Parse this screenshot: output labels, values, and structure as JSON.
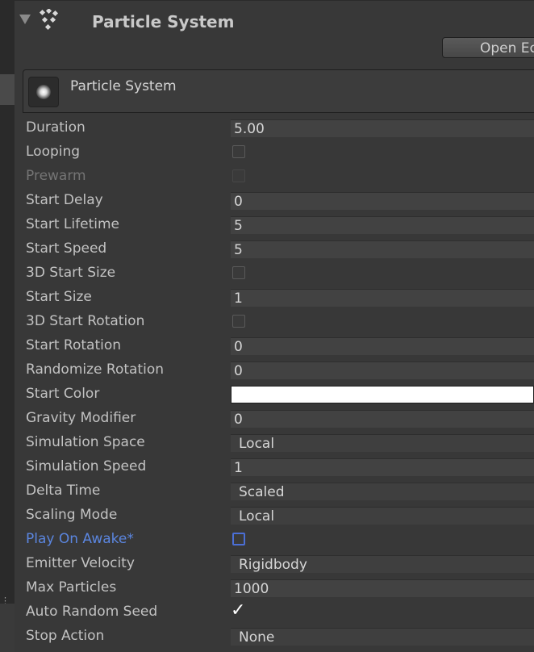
{
  "header": {
    "title": "Particle System",
    "open_editor_label": "Open Ec"
  },
  "module": {
    "title": "Particle System"
  },
  "properties": [
    {
      "label": "Duration",
      "type": "number",
      "value": "5.00"
    },
    {
      "label": "Looping",
      "type": "checkbox",
      "checked": false
    },
    {
      "label": "Prewarm",
      "type": "checkbox",
      "checked": false,
      "disabled": true
    },
    {
      "label": "Start Delay",
      "type": "number",
      "value": "0"
    },
    {
      "label": "Start Lifetime",
      "type": "number",
      "value": "5"
    },
    {
      "label": "Start Speed",
      "type": "number",
      "value": "5"
    },
    {
      "label": "3D Start Size",
      "type": "checkbox",
      "checked": false
    },
    {
      "label": "Start Size",
      "type": "number",
      "value": "1"
    },
    {
      "label": "3D Start Rotation",
      "type": "checkbox",
      "checked": false
    },
    {
      "label": "Start Rotation",
      "type": "number",
      "value": "0"
    },
    {
      "label": "Randomize Rotation",
      "type": "number",
      "value": "0"
    },
    {
      "label": "Start Color",
      "type": "color",
      "value": "#ffffff"
    },
    {
      "label": "Gravity Modifier",
      "type": "number",
      "value": "0"
    },
    {
      "label": "Simulation Space",
      "type": "dropdown",
      "value": "Local"
    },
    {
      "label": "Simulation Speed",
      "type": "number",
      "value": "1"
    },
    {
      "label": "Delta Time",
      "type": "dropdown",
      "value": "Scaled"
    },
    {
      "label": "Scaling Mode",
      "type": "dropdown",
      "value": "Local"
    },
    {
      "label": "Play On Awake*",
      "type": "checkbox",
      "checked": false,
      "modified": true
    },
    {
      "label": "Emitter Velocity",
      "type": "dropdown",
      "value": "Rigidbody"
    },
    {
      "label": "Max Particles",
      "type": "number",
      "value": "1000"
    },
    {
      "label": "Auto Random Seed",
      "type": "checkbox",
      "checked": true
    },
    {
      "label": "Stop Action",
      "type": "dropdown",
      "value": "None"
    }
  ],
  "colors": {
    "background": "#383838",
    "modified_label": "#5b86e0",
    "disabled_label": "#747474"
  }
}
